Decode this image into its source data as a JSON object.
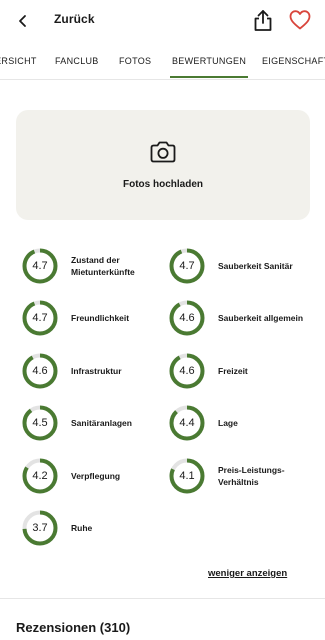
{
  "header": {
    "back_label": "Zurück"
  },
  "tabs": [
    {
      "label": "ÜBERSICHT",
      "active": false
    },
    {
      "label": "FANCLUB",
      "active": false
    },
    {
      "label": "FOTOS",
      "active": false
    },
    {
      "label": "BEWERTUNGEN",
      "active": true
    },
    {
      "label": "EIGENSCHAFTEN",
      "active": false
    }
  ],
  "upload": {
    "label": "Fotos hochladen"
  },
  "colors": {
    "accent": "#4a7a32",
    "ring_track": "#e3e3e3",
    "heart": "#d9453c",
    "upload_bg": "#f2f1ec"
  },
  "ratings": {
    "max": 5,
    "items": [
      {
        "value": "4.7",
        "label": "Zustand der Mietunterkünfte"
      },
      {
        "value": "4.7",
        "label": "Sauberkeit Sanitär"
      },
      {
        "value": "4.7",
        "label": "Freundlichkeit"
      },
      {
        "value": "4.6",
        "label": "Sauberkeit allgemein"
      },
      {
        "value": "4.6",
        "label": "Infrastruktur"
      },
      {
        "value": "4.6",
        "label": "Freizeit"
      },
      {
        "value": "4.5",
        "label": "Sanitäranlagen"
      },
      {
        "value": "4.4",
        "label": "Lage"
      },
      {
        "value": "4.2",
        "label": "Verpflegung"
      },
      {
        "value": "4.1",
        "label": "Preis-Leistungs-Verhältnis"
      },
      {
        "value": "3.7",
        "label": "Ruhe"
      }
    ]
  },
  "less_link": "weniger anzeigen",
  "reviews": {
    "title": "Rezensionen (310)"
  }
}
